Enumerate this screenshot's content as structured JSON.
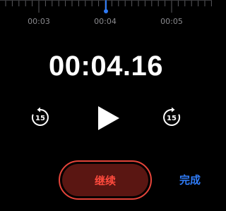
{
  "timeline": {
    "tick_labels": [
      "00:03",
      "00:04",
      "00:05"
    ],
    "playhead_color": "#2f7bf6"
  },
  "player": {
    "elapsed_time": "00:04.16",
    "skip_back_seconds": "15",
    "skip_forward_seconds": "15",
    "play_icon": "play-icon",
    "skip_back_icon": "skip-back-15-icon",
    "skip_forward_icon": "skip-forward-15-icon"
  },
  "actions": {
    "resume_label": "继续",
    "done_label": "完成",
    "resume_color": "#ff4a3d",
    "done_color": "#2f7bf6"
  }
}
